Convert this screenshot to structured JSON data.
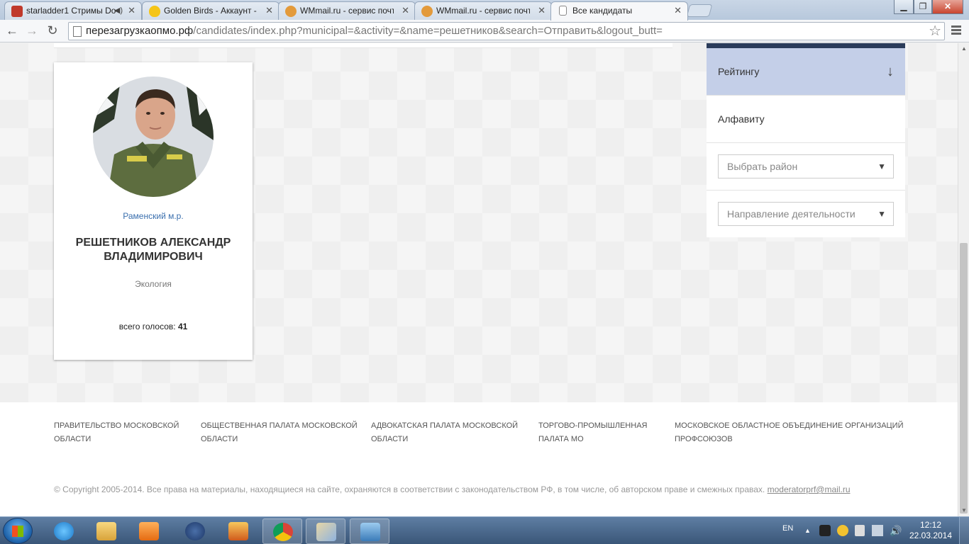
{
  "browser": {
    "tabs": [
      {
        "title": "starladder1 Стримы Do",
        "favicon_color": "#c0392b"
      },
      {
        "title": "Golden Birds - Аккаунт - I",
        "favicon_color": "#f5c518"
      },
      {
        "title": "WMmail.ru - сервис почт",
        "favicon_color": "#e39a3b"
      },
      {
        "title": "WMmail.ru - сервис почт",
        "favicon_color": "#e39a3b"
      },
      {
        "title": "Все кандидаты",
        "favicon_color": "#ffffff"
      }
    ],
    "url_host": "перезагрузкаопмо.рф",
    "url_path": "/candidates/index.php?municipal=&activity=&name=решетников&search=Отправить&logout_butt="
  },
  "candidate": {
    "district": "Раменский м.р.",
    "name": "РЕШЕТНИКОВ АЛЕКСАНДР ВЛАДИМИРОВИЧ",
    "activity": "Экология",
    "votes_label": "всего голосов:",
    "votes_value": "41"
  },
  "sidebar": {
    "sort_rating": "Рейтингу",
    "sort_alphabet": "Алфавиту",
    "district_placeholder": "Выбрать район",
    "activity_placeholder": "Направление деятельности"
  },
  "footer": {
    "links": [
      "ПРАВИТЕЛЬСТВО МОСКОВСКОЙ ОБЛАСТИ",
      "ОБЩЕСТВЕННАЯ ПАЛАТА МОСКОВСКОЙ ОБЛАСТИ",
      "АДВОКАТСКАЯ ПАЛАТА МОСКОВСКОЙ ОБЛАСТИ",
      "ТОРГОВО-ПРОМЫШЛЕННАЯ ПАЛАТА МО",
      "МОСКОВСКОЕ ОБЛАСТНОЕ ОБЪЕДИНЕНИЕ ОРГАНИЗАЦИЙ ПРОФСОЮЗОВ"
    ],
    "copyright": "© Copyright 2005-2014. Все права на материалы, находящиеся на сайте, охраняются в соответствии с законодательством РФ, в том числе, об авторском праве и смежных правах.",
    "email": "moderatorprf@mail.ru"
  },
  "taskbar": {
    "lang": "EN",
    "time": "12:12",
    "date": "22.03.2014"
  },
  "colors": {
    "accent_dark": "#2b3c5a",
    "sort_active_bg": "#c4cfe8",
    "district_link": "#3a6fae"
  }
}
